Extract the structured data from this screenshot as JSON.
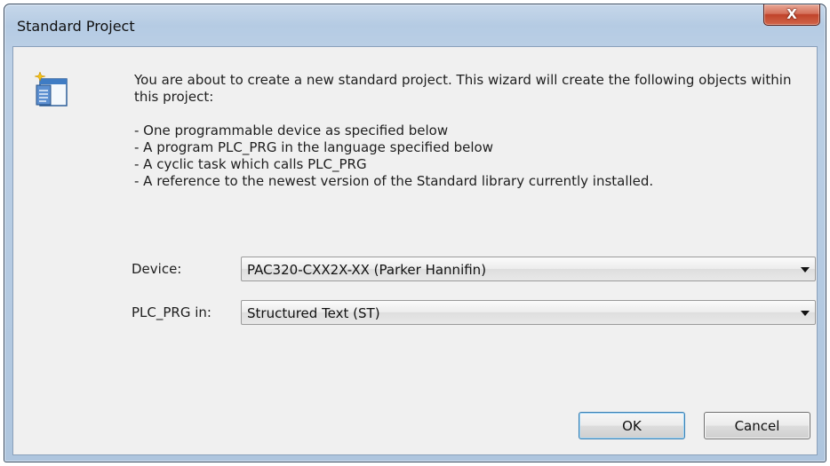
{
  "window": {
    "title": "Standard Project",
    "close_glyph": "X"
  },
  "description": {
    "intro": "You are about to create a new standard project. This wizard will create the following objects within this project:",
    "items": [
      "- One programmable device as specified below",
      "- A program PLC_PRG in the language specified below",
      "- A cyclic task which calls PLC_PRG",
      "- A reference to the newest version of the Standard library currently installed."
    ]
  },
  "form": {
    "device_label": "Device:",
    "device_value": "PAC320-CXX2X-XX (Parker Hannifin)",
    "language_label": "PLC_PRG in:",
    "language_value": "Structured Text (ST)"
  },
  "buttons": {
    "ok": "OK",
    "cancel": "Cancel"
  },
  "icons": {
    "wizard": "project-wizard-icon",
    "close": "close-icon",
    "dropdown": "chevron-down-icon"
  },
  "colors": {
    "close_button": "#c0432a",
    "titlebar": "#b5cbe3",
    "client_background": "#f0f0f0",
    "default_button_border": "#3c7fb1"
  }
}
